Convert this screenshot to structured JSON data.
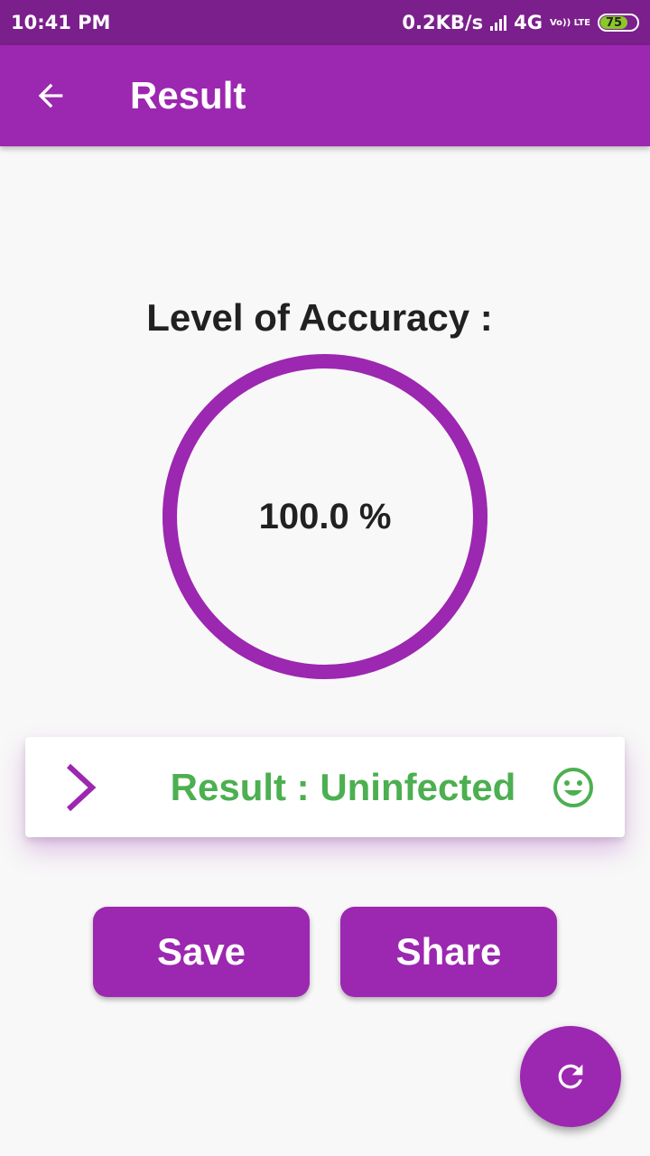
{
  "status_bar": {
    "time": "10:41 PM",
    "network_speed": "0.2KB/s",
    "network_type": "4G",
    "volte_label": "Vo)) LTE",
    "battery": "75"
  },
  "app_bar": {
    "title": "Result",
    "back_icon": "arrow-back-icon"
  },
  "accuracy": {
    "label": "Level of Accuracy :",
    "value_text": "100.0 %",
    "fraction": 1.0
  },
  "result_card": {
    "text": "Result : Uninfected",
    "chevron_icon": "chevron-right-icon",
    "status_icon": "smiley-icon"
  },
  "buttons": {
    "save_label": "Save",
    "share_label": "Share"
  },
  "fab": {
    "icon": "refresh-icon"
  },
  "colors": {
    "primary": "#9c27b0",
    "primary_dark": "#7b1f8c",
    "success": "#4caf50",
    "background": "#f8f8f8"
  }
}
